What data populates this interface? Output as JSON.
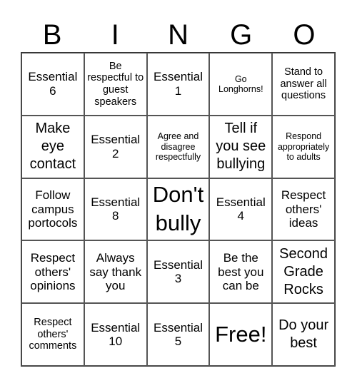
{
  "header": {
    "letters": [
      "B",
      "I",
      "N",
      "G",
      "O"
    ]
  },
  "board": {
    "rows": [
      [
        "Essential 6",
        "Be respectful to guest speakers",
        "Essential 1",
        "Go Longhorns!",
        "Stand to answer all questions"
      ],
      [
        "Make eye contact",
        "Essential 2",
        "Agree and disagree respectfully",
        "Tell if you see bullying",
        "Respond appropriately to adults"
      ],
      [
        "Follow campus portocols",
        "Essential 8",
        "Don't bully",
        "Essential 4",
        "Respect others' ideas"
      ],
      [
        "Respect others' opinions",
        "Always say thank you",
        "Essential 3",
        "Be the best you can be",
        "Second Grade Rocks"
      ],
      [
        "Respect others' comments",
        "Essential 10",
        "Essential 5",
        "Free!",
        "Do your best"
      ]
    ]
  }
}
